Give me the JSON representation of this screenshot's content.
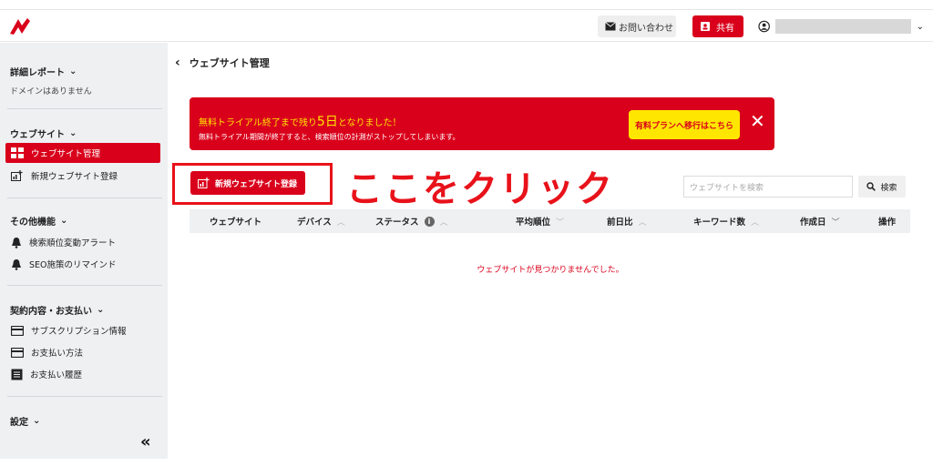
{
  "header": {
    "contact_label": "お問い合わせ",
    "share_label": "共有"
  },
  "sidebar": {
    "sections": [
      {
        "title": "詳細レポート",
        "note": "ドメインはありません"
      },
      {
        "title": "ウェブサイト",
        "items": [
          "ウェブサイト管理",
          "新規ウェブサイト登録"
        ]
      },
      {
        "title": "その他機能",
        "items": [
          "検索順位変動アラート",
          "SEO施策のリマインド"
        ]
      },
      {
        "title": "契約内容・お支払い",
        "items": [
          "サブスクリプション情報",
          "お支払い方法",
          "お支払い履歴"
        ]
      },
      {
        "title": "設定"
      }
    ],
    "collapse_glyph": "«"
  },
  "main": {
    "back_glyph": "‹",
    "page_title": "ウェブサイト管理",
    "banner": {
      "line1_prefix": "無料トライアル終了まで残り",
      "line1_days": "5日",
      "line1_suffix": "となりました！",
      "line2": "無料トライアル期間が終了すると、検索順位の計測がストップしてしまいます。",
      "upgrade_label": "有料プランへ移行はこちら",
      "close_glyph": "✕"
    },
    "new_site_label": "新規ウェブサイト登録",
    "annotation": "ここをクリック",
    "search_placeholder": "ウェブサイトを検索",
    "search_label": "検索",
    "columns": [
      "ウェブサイト",
      "デバイス",
      "ステータス",
      "平均順位",
      "前日比",
      "キーワード数",
      "作成日",
      "操作"
    ],
    "empty_message": "ウェブサイトが見つかりませんでした。"
  },
  "colors": {
    "accent": "#d9001b",
    "banner_text": "#ffe600",
    "annotation": "#e8121a"
  }
}
